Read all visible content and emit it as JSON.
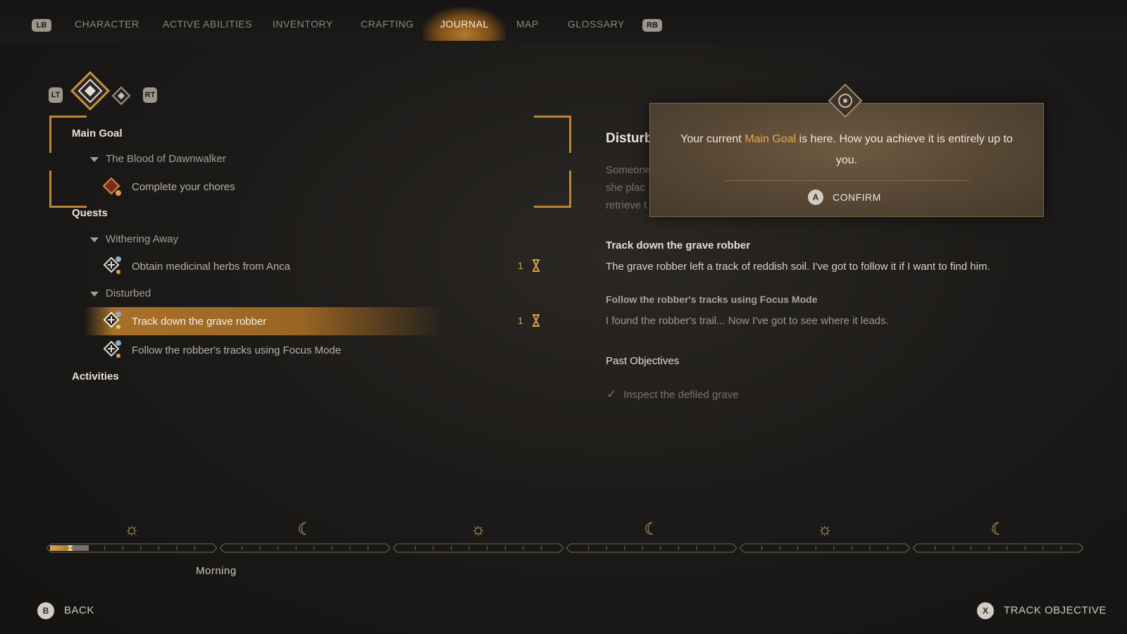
{
  "tabs": {
    "lb": "LB",
    "rb": "RB",
    "items": [
      "CHARACTER",
      "ACTIVE ABILITIES",
      "INVENTORY",
      "CRAFTING",
      "JOURNAL",
      "MAP",
      "GLOSSARY"
    ],
    "active": "JOURNAL"
  },
  "filter": {
    "lt": "LT",
    "rt": "RT"
  },
  "journal": {
    "main_goal": "Main Goal",
    "main_group": "The Blood of Dawnwalker",
    "main_item": "Complete your chores",
    "quests": "Quests",
    "group1": "Withering Away",
    "group1_item": "Obtain medicinal herbs from Anca",
    "group1_count": "1",
    "group2": "Disturbed",
    "group2_item1": "Track down the grave robber",
    "group2_item1_count": "1",
    "group2_item2": "Follow the robber's tracks using Focus Mode",
    "activities": "Activities"
  },
  "detail": {
    "title": "Disturb",
    "desc_lines": [
      "Someone",
      "she plac",
      "retrieve t"
    ],
    "obj1_title": "Track down the grave robber",
    "obj1_text": "The grave robber left a track of reddish soil. I've got to follow it if I want to find him.",
    "obj2_title": "Follow the robber's tracks using Focus Mode",
    "obj2_text": "I found the robber's trail... Now I've got to see where it leads.",
    "past_title": "Past Objectives",
    "past_item": "Inspect the defiled grave"
  },
  "popup": {
    "text_before": "Your current ",
    "highlight": "Main Goal",
    "text_after": " is here. How you achieve it is entirely up to",
    "line2": "you.",
    "button_key": "A",
    "button_label": "CONFIRM"
  },
  "timeline": {
    "icons": [
      "sun-icon",
      "moon-icon",
      "sun-icon",
      "moon-icon",
      "sun-icon",
      "moon-icon"
    ],
    "current_label": "Morning",
    "progress": 0.12
  },
  "footer": {
    "back_key": "B",
    "back_label": "BACK",
    "track_key": "X",
    "track_label": "TRACK OBJECTIVE"
  },
  "colors": {
    "accent": "#b98637",
    "highlight_text": "#e8a94a",
    "count": "#d2a24c"
  }
}
